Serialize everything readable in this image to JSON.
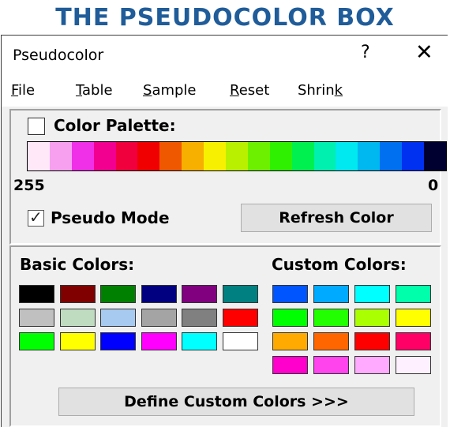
{
  "banner": {
    "title": "THE PSEUDOCOLOR BOX"
  },
  "window": {
    "title": "Pseudocolor",
    "help_glyph": "?",
    "close_glyph": "✕"
  },
  "menu": {
    "file": {
      "first": "F",
      "rest": "ile"
    },
    "table": {
      "first": "T",
      "rest": "able"
    },
    "sample": {
      "first": "S",
      "rest": "ample"
    },
    "reset": {
      "first": "R",
      "rest": "eset"
    },
    "shrink": {
      "pre": "Shrin",
      "ul": "k"
    }
  },
  "palette_section": {
    "checkbox_label": "Color Palette:",
    "checkbox_checked": false,
    "scale_left": "255",
    "scale_right": "0",
    "colors": [
      "#ffe8f8",
      "#f7a0f0",
      "#f030e8",
      "#f20090",
      "#f0003c",
      "#f00000",
      "#f05800",
      "#f7b000",
      "#f7f000",
      "#b8f000",
      "#6cf000",
      "#2ef000",
      "#00f050",
      "#00f0b0",
      "#00e8f0",
      "#00b8f0",
      "#0070f0",
      "#0030f0",
      "#000030"
    ],
    "pseudo_mode_label": "Pseudo Mode",
    "pseudo_mode_checked": true,
    "refresh_button": "Refresh Color"
  },
  "colors_section": {
    "basic_label": "Basic Colors:",
    "custom_label": "Custom Colors:",
    "basic_colors": [
      [
        "#000000",
        "#800000",
        "#008000",
        "#000080",
        "#800080",
        "#008080"
      ],
      [
        "#c0c0c0",
        "#c0dcc0",
        "#a6caf0",
        "#a4a4a4",
        "#808080",
        "#ff0000"
      ],
      [
        "#00ff00",
        "#ffff00",
        "#0000ff",
        "#ff00ff",
        "#00ffff",
        "#ffffff"
      ]
    ],
    "custom_colors": [
      [
        "#0055ff",
        "#00aaff",
        "#00ffff",
        "#00ffaa"
      ],
      [
        "#00ff00",
        "#22ff00",
        "#aaff00",
        "#ffff00"
      ],
      [
        "#ffaa00",
        "#ff6600",
        "#ff0000",
        "#ff0066"
      ],
      [
        "#ff00cc",
        "#ff44ee",
        "#ffaaff",
        "#fff0ff"
      ]
    ],
    "define_button": "Define Custom Colors >>>"
  }
}
